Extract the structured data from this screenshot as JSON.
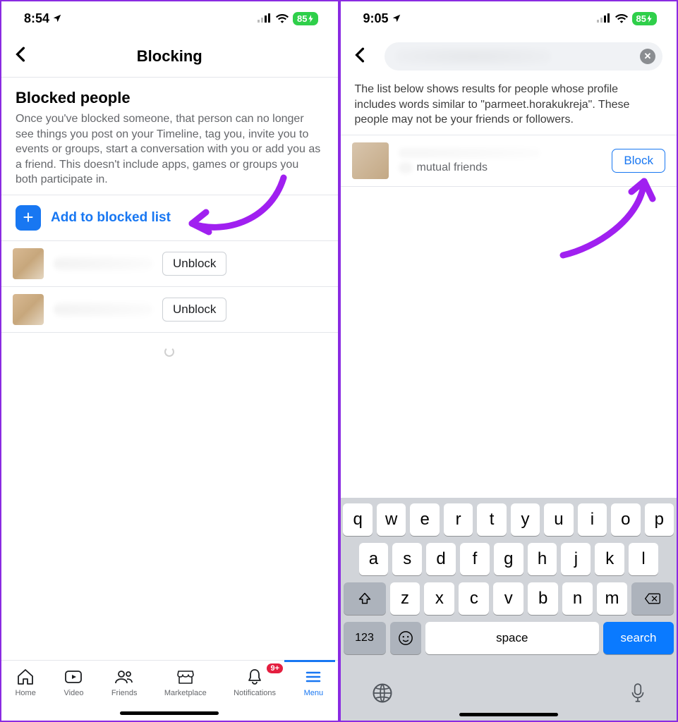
{
  "left": {
    "status": {
      "time": "8:54",
      "battery": "85"
    },
    "nav": {
      "title": "Blocking"
    },
    "section": {
      "title": "Blocked people",
      "desc": "Once you've blocked someone, that person can no longer see things you post on your Timeline, tag you, invite you to events or groups, start a conversation with you or add you as a friend. This doesn't include apps, games or groups you both participate in."
    },
    "add_label": "Add to blocked list",
    "unblock_label": "Unblock",
    "tabs": {
      "home": "Home",
      "video": "Video",
      "friends": "Friends",
      "marketplace": "Marketplace",
      "notifications": "Notifications",
      "menu": "Menu",
      "badge": "9+"
    }
  },
  "right": {
    "status": {
      "time": "9:05",
      "battery": "85"
    },
    "desc": "The list below shows results for people whose profile includes words similar to \"parmeet.horakukreja\". These people may not be your friends or followers.",
    "result_sub": "mutual friends",
    "block_label": "Block",
    "kbd": {
      "r1": [
        "q",
        "w",
        "e",
        "r",
        "t",
        "y",
        "u",
        "i",
        "o",
        "p"
      ],
      "r2": [
        "a",
        "s",
        "d",
        "f",
        "g",
        "h",
        "j",
        "k",
        "l"
      ],
      "r3": [
        "z",
        "x",
        "c",
        "v",
        "b",
        "n",
        "m"
      ],
      "numkey": "123",
      "space": "space",
      "search": "search"
    }
  }
}
